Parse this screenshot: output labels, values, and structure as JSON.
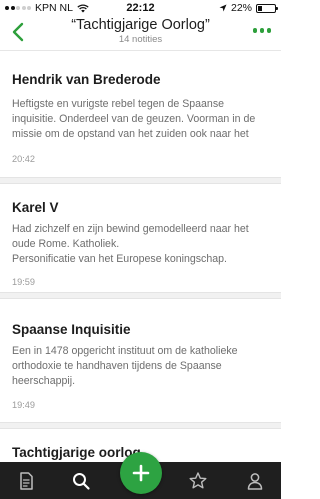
{
  "status_bar": {
    "carrier": "KPN NL",
    "time": "22:12",
    "battery_percent": "22%",
    "signal_bars": 2,
    "battery_level": 0.22
  },
  "header": {
    "title": "“Tachtigjarige Oorlog”",
    "subtitle": "14 notities",
    "back_icon": "chevron-left-icon",
    "more_icon": "more-dots-icon",
    "accent_color": "#2d9f3b"
  },
  "notes": [
    {
      "title": "Hendrik van Brederode",
      "body": [
        "Heftigste en vurigste rebel tegen de Spaanse",
        "inquisitie. Onderdeel van de geuzen. Voorman in de",
        "missie om de opstand van het zuiden ook naar het"
      ],
      "time": "20:42"
    },
    {
      "title": "Karel V",
      "body": [
        "Had zichzelf en zijn bewind gemodelleerd naar het",
        "oude Rome. Katholiek.",
        "Personificatie van het Europese koningschap."
      ],
      "time": "19:59"
    },
    {
      "title": "Spaanse Inquisitie",
      "body": [
        "Een in 1478 opgericht instituut om de katholieke",
        "orthodoxie te handhaven tijdens de Spaanse",
        "heerschappij."
      ],
      "time": "19:49"
    },
    {
      "title": "Tachtigjarige oorlog"
    }
  ],
  "tab_bar": {
    "items": [
      "notes-icon",
      "search-icon",
      "add-icon",
      "star-icon",
      "account-icon"
    ],
    "active": "search-icon",
    "fab_color": "#2da342"
  }
}
